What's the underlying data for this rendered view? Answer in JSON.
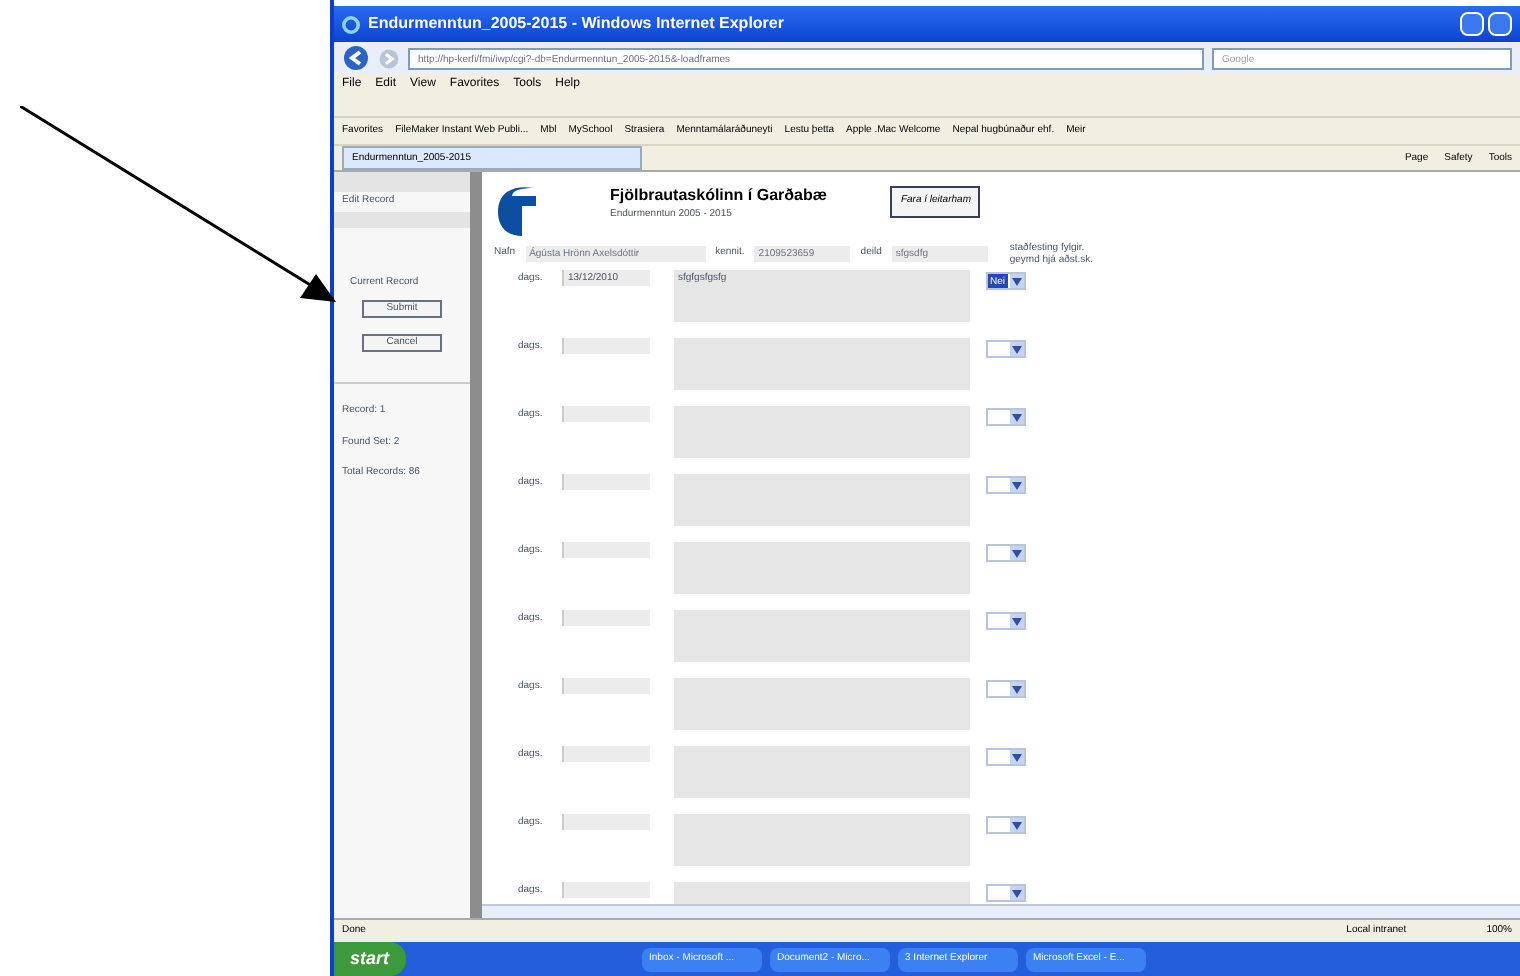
{
  "window": {
    "title": "Endurmenntun_2005-2015 - Windows Internet Explorer"
  },
  "address_bar": {
    "url": "http://hp-kerfi/fmi/iwp/cgi?-db=Endurmenntun_2005-2015&-loadframes",
    "search_placeholder": "Google"
  },
  "menu": [
    "File",
    "Edit",
    "View",
    "Favorites",
    "Tools",
    "Help"
  ],
  "favorites_bar": [
    "Favorites",
    "FileMaker Instant Web Publi...",
    "Mbl",
    "MySchool",
    "Strasiera",
    "Menntamálaráðuneyti",
    "Lestu þetta",
    "Apple .Mac Welcome",
    "Nepal hugbúnaður ehf.",
    "Meir"
  ],
  "tab": {
    "label": "Endurmenntun_2005-2015"
  },
  "command_bar": [
    "Page",
    "Safety",
    "Tools"
  ],
  "sidebar": {
    "mode": "Edit Record",
    "status": "Current Record",
    "buttons": [
      "Submit",
      "Cancel"
    ],
    "stats": [
      "Record: 1",
      "Found Set: 2",
      "Total Records: 86"
    ]
  },
  "header": {
    "title": "Fjölbrautaskólinn í Garðabæ",
    "subtitle": "Endurmenntun 2005 - 2015",
    "button": "Fara í leitarham"
  },
  "person": [
    {
      "label": "Nafn",
      "value": "Ágústa Hrönn Axelsdóttir"
    },
    {
      "label": "kennit.",
      "value": "2109523659"
    },
    {
      "label": "deild",
      "value": "sfgsdfg"
    }
  ],
  "confirm_heading": "staðfesting fylgir. geymd hjá aðst.sk.",
  "rows": [
    {
      "label": "dags.",
      "date": "13/12/2010",
      "text": "sfgfgsfgsfg",
      "choice": "Nei"
    },
    {
      "label": "dags."
    },
    {
      "label": "dags."
    },
    {
      "label": "dags."
    },
    {
      "label": "dags."
    },
    {
      "label": "dags."
    },
    {
      "label": "dags."
    },
    {
      "label": "dags."
    },
    {
      "label": "dags."
    },
    {
      "label": "dags."
    }
  ],
  "status_bar": {
    "status": "Done",
    "zone": "Local intranet",
    "zoom": "100%"
  },
  "taskbar": {
    "start": "start",
    "tasks": [
      "Inbox - Microsoft ...",
      "Document2 - Micro...",
      "3 Internet Explorer",
      "Microsoft Excel - E..."
    ]
  }
}
